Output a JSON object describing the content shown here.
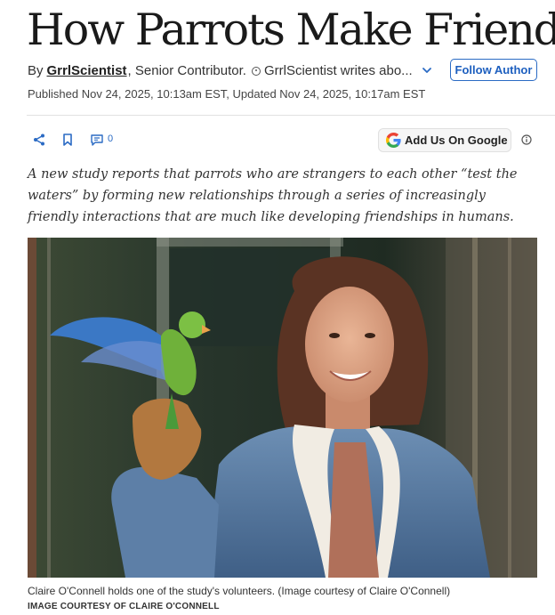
{
  "article": {
    "headline": "How Parrots Make Friends",
    "byline_prefix": "By",
    "author": "GrrlScientist",
    "author_role": ", Senior Contributor.",
    "author_bio": "GrrlScientist writes abo...",
    "follow_label": "Follow Author",
    "dates": "Published Nov 24, 2025, 10:13am EST, Updated Nov 24, 2025, 10:17am EST",
    "summary": "A new study reports that parrots who are strangers to each other “test the waters” by forming new relationships through a series of increasingly friendly interactions that are much like developing friendships in humans."
  },
  "toolbar": {
    "comment_count": "0",
    "google_label": "Add Us On Google",
    "icons": [
      "share-icon",
      "bookmark-icon",
      "comment-icon",
      "google-g-icon",
      "info-icon",
      "chevron-down-icon"
    ]
  },
  "image": {
    "caption": "Claire O'Connell holds one of the study's volunteers. (Image courtesy of Claire O'Connell)",
    "credit": "IMAGE COURTESY OF CLAIRE O'CONNELL"
  },
  "colors": {
    "accent": "#1d5fbf",
    "text": "#222222",
    "divider": "#e2e2e2"
  }
}
